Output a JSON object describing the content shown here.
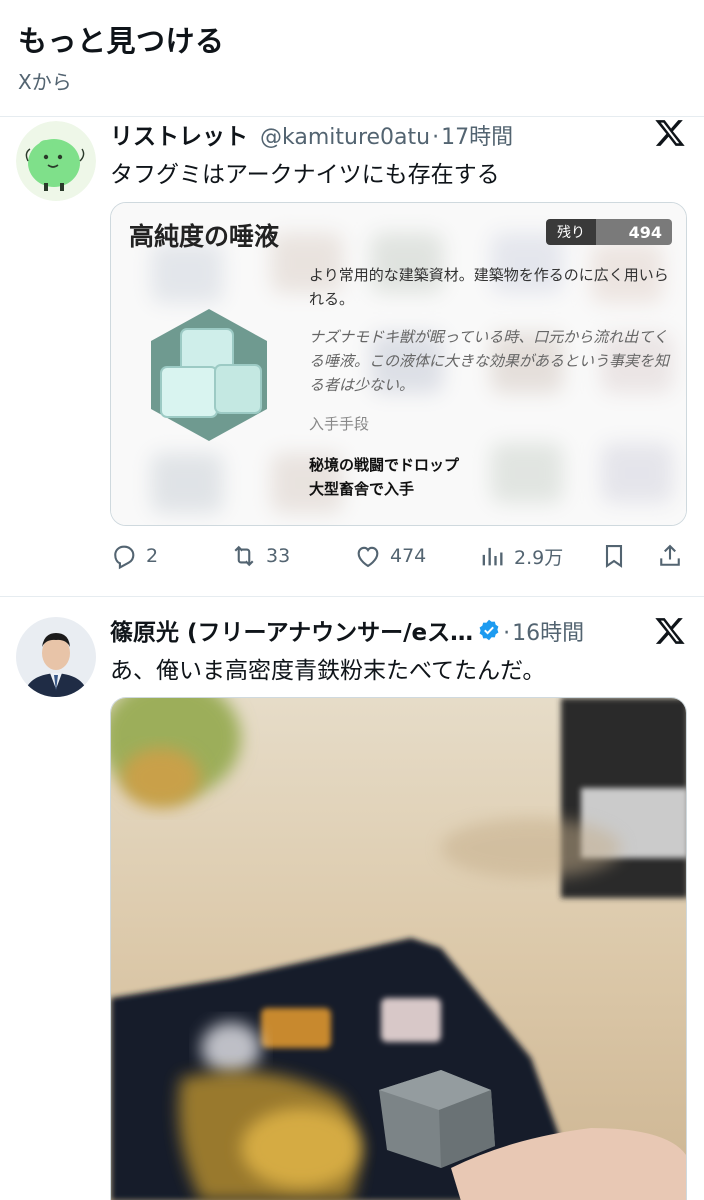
{
  "section": {
    "title": "もっと見つける",
    "subtitle": "Xから"
  },
  "tweets": [
    {
      "name": "リストレット",
      "handle": "@kamiture0atu",
      "dot": "·",
      "time": "17時間",
      "text": "タフグミはアークナイツにも存在する",
      "verified": false,
      "card": {
        "title": "高純度の唾液",
        "remain_label": "残り",
        "remain_value": "494",
        "desc": "より常用的な建築資材。建築物を作るのに広く用いられる。",
        "lore": "ナズナモドキ獣が眠っている時、口元から流れ出てくる唾液。この液体に大きな効果があるという事実を知る者は少ない。",
        "acq_label": "入手手段",
        "acq_line1": "秘境の戦闘でドロップ",
        "acq_line2": "大型畜舎で入手"
      },
      "actions": {
        "reply": "2",
        "repost": "33",
        "like": "474",
        "views": "2.9万"
      }
    },
    {
      "name": "篠原光 (フリーアナウンサー/eス…",
      "handle": "",
      "dot": "·",
      "time": "16時間",
      "text": "あ、俺いま高密度青鉄粉末たべてたんだ。",
      "verified": true
    }
  ],
  "icons": {
    "reply": "reply-icon",
    "repost": "repost-icon",
    "like": "like-icon",
    "views": "views-icon",
    "bookmark": "bookmark-icon",
    "share": "share-icon",
    "x_logo": "x-logo-icon",
    "verified": "verified-badge-icon"
  },
  "colors": {
    "text": "#0f1419",
    "secondary": "#536471",
    "verified": "#1d9bf0",
    "divider": "#e6ecf0"
  }
}
